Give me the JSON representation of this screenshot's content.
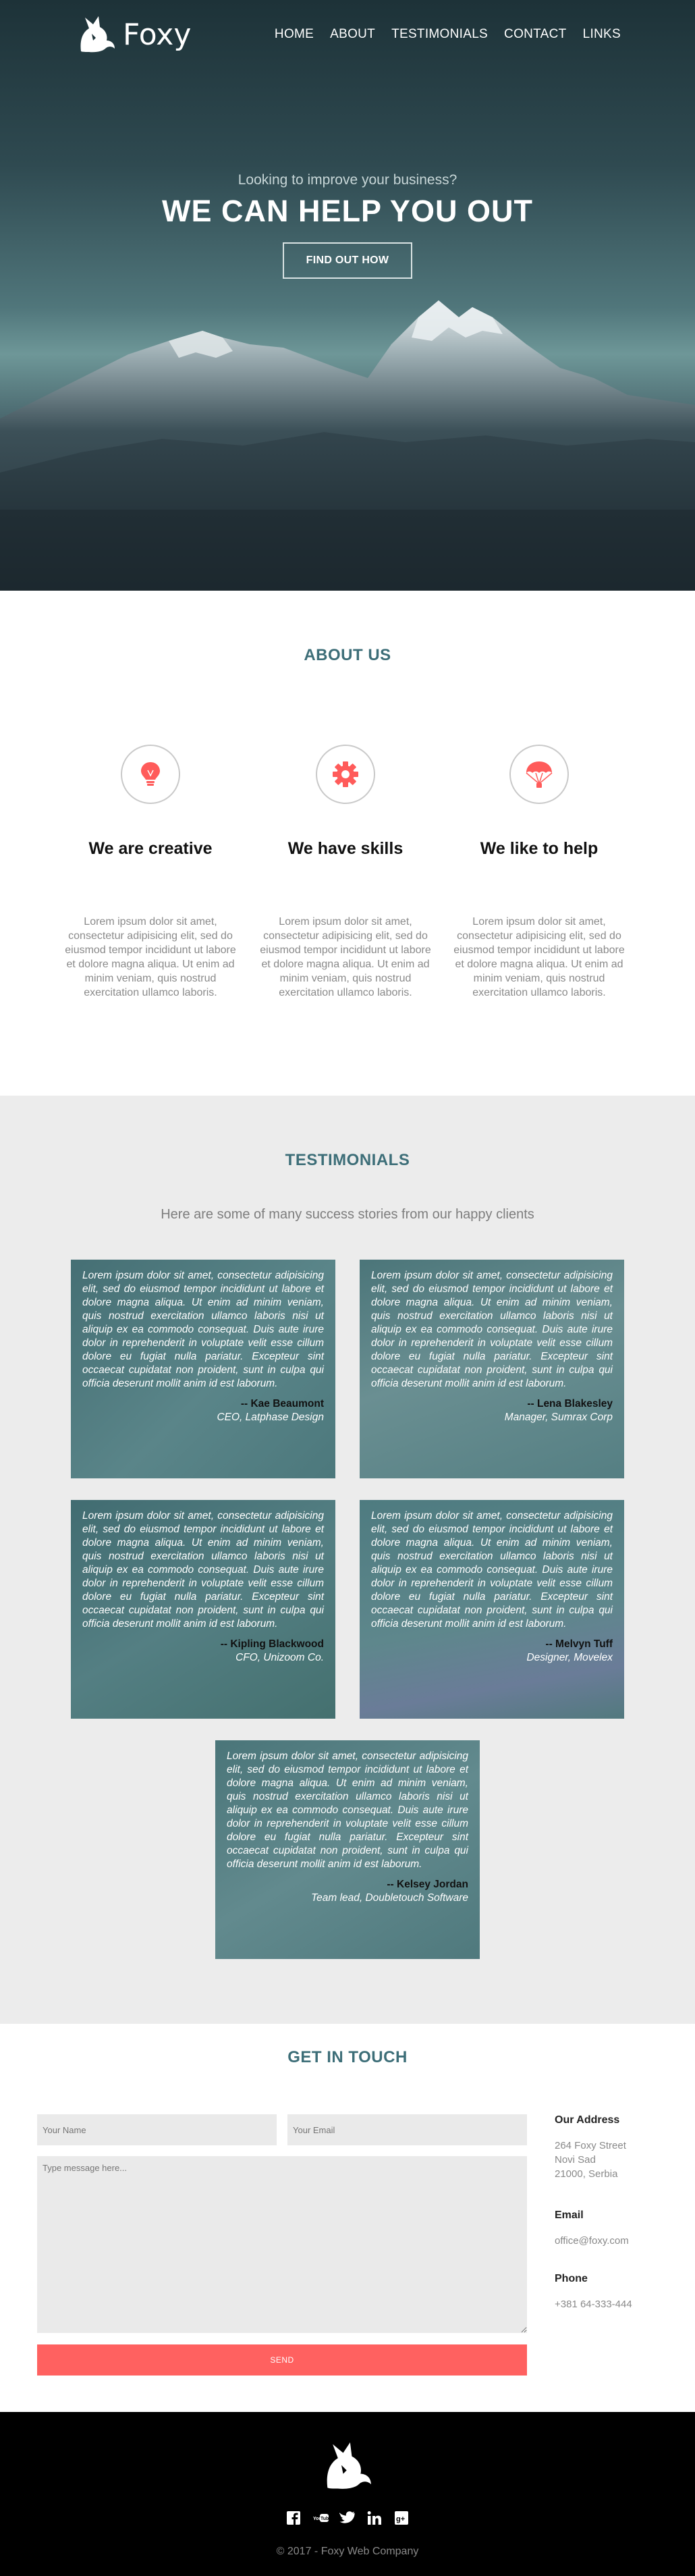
{
  "brand": {
    "name": "Foxy"
  },
  "nav": {
    "items": [
      "HOME",
      "ABOUT",
      "TESTIMONIALS",
      "CONTACT",
      "LINKS"
    ]
  },
  "hero": {
    "subtitle": "Looking to improve your business?",
    "title": "WE CAN HELP YOU OUT",
    "button": "FIND OUT HOW"
  },
  "about": {
    "title": "ABOUT US",
    "features": [
      {
        "icon": "lightbulb-icon",
        "title": "We are creative",
        "text": "Lorem ipsum dolor sit amet, consectetur adipisicing elit, sed do eiusmod tempor incididunt ut labore et dolore magna aliqua. Ut enim ad minim veniam, quis nostrud exercitation ullamco laboris."
      },
      {
        "icon": "gear-icon",
        "title": "We have skills",
        "text": "Lorem ipsum dolor sit amet, consectetur adipisicing elit, sed do eiusmod tempor incididunt ut labore et dolore magna aliqua. Ut enim ad minim veniam, quis nostrud exercitation ullamco laboris."
      },
      {
        "icon": "parachute-icon",
        "title": "We like to help",
        "text": "Lorem ipsum dolor sit amet, consectetur adipisicing elit, sed do eiusmod tempor incididunt ut labore et dolore magna aliqua. Ut enim ad minim veniam, quis nostrud exercitation ullamco laboris."
      }
    ],
    "icon_color": "#ff5b5a"
  },
  "testimonials": {
    "title": "TESTIMONIALS",
    "subtitle": "Here are some of many success stories from our happy clients",
    "quote": "Lorem ipsum dolor sit amet, consectetur adipisicing elit, sed do eiusmod tempor incididunt ut labore et dolore magna aliqua. Ut enim ad minim veniam, quis nostrud exercitation ullamco laboris nisi ut aliquip ex ea commodo consequat. Duis aute irure dolor in reprehenderit in voluptate velit esse cillum dolore eu fugiat nulla pariatur. Excepteur sint occaecat cupidatat non proident, sunt in culpa qui officia deserunt mollit anim id est laborum.",
    "items": [
      {
        "name": "-- Kae Beaumont",
        "role": "CEO, Latphase Design"
      },
      {
        "name": "-- Lena Blakesley",
        "role": "Manager, Sumrax Corp"
      },
      {
        "name": "-- Kipling Blackwood",
        "role": "CFO, Unizoom Co."
      },
      {
        "name": "-- Melvyn Tuff",
        "role": "Designer, Movelex"
      },
      {
        "name": "-- Kelsey Jordan",
        "role": "Team lead, Doubletouch Software"
      }
    ],
    "card_color": "#4f7c80"
  },
  "contact": {
    "title": "GET IN TOUCH",
    "name_placeholder": "Your Name",
    "email_placeholder": "Your Email",
    "message_placeholder": "Type message here...",
    "send": "SEND",
    "address_heading": "Our Address",
    "address_lines": [
      "264 Foxy Street",
      "Novi Sad",
      "21000, Serbia"
    ],
    "email_heading": "Email",
    "email": "office@foxy.com",
    "phone_heading": "Phone",
    "phone": "+381 64-333-444",
    "accent": "#ff6160"
  },
  "footer": {
    "socials": [
      "facebook-icon",
      "youtube-icon",
      "twitter-icon",
      "linkedin-icon",
      "google-plus-icon"
    ],
    "copyright": "© 2017 - Foxy Web Company"
  }
}
